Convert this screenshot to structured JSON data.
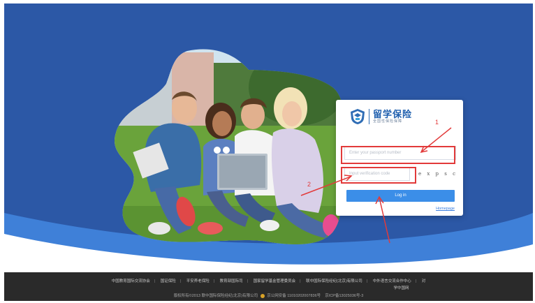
{
  "login": {
    "logo_title": "留学保险",
    "logo_subtitle": "全国性保险保障",
    "passport_placeholder": "Enter your passport number",
    "code_placeholder": "Input verification code",
    "captcha_text": "e x p s c",
    "login_label": "Log in",
    "homepage_label": "Homepage"
  },
  "annotations": {
    "step1": "1",
    "step2": "2"
  },
  "footer": {
    "links": [
      "中国教育国际交流协会",
      "国证保险",
      "平安养老保险",
      "教育部国际司",
      "国家留学基金管理委员会",
      "联中国际保险经纪(北京)有限公司",
      "中外语言交流合作中心",
      "对"
    ],
    "links_line2": "学中国网",
    "copyright": "版权所有©2013 联中国际保险经纪(北京)有限公司",
    "police_record": "京公网安备 11010202007836号",
    "icp_record": "京ICP备13025036号-3"
  },
  "colors": {
    "brand_blue": "#2c58a6",
    "button_blue": "#3b8ee8",
    "annotation_red": "#e23a3a",
    "footer_bg": "#2a2a2a"
  }
}
